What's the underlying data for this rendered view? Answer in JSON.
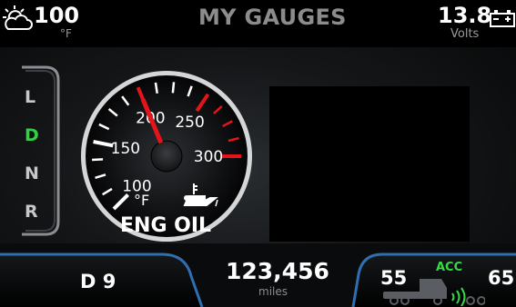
{
  "top_bar": {
    "weather_icon": "partly-sunny-icon",
    "outside_temp": "100",
    "outside_temp_unit": "°F",
    "title": "MY GAUGES",
    "battery_voltage": "13.8",
    "battery_unit": "Volts",
    "battery_icon": "battery-icon"
  },
  "gear_selector": {
    "gears": [
      "L",
      "D",
      "N",
      "R"
    ],
    "selected": "D"
  },
  "gauge": {
    "label": "ENG OIL",
    "unit": "°F",
    "icon": "oil-can-icon",
    "tick_labels": [
      "100",
      "150",
      "200",
      "250",
      "300"
    ],
    "value": 200,
    "min": 100,
    "max": 300
  },
  "bottom_bar": {
    "gear_range": "D 9",
    "odometer": "123,456",
    "odometer_unit": "miles",
    "set_speed": "55",
    "acc_label": "ACC",
    "target_speed": "65",
    "acc_icon": "truck-radar-icon"
  },
  "colors": {
    "accent_blue": "#2f6fb0",
    "acc_green": "#33dd44",
    "needle_red": "#e3141b"
  }
}
